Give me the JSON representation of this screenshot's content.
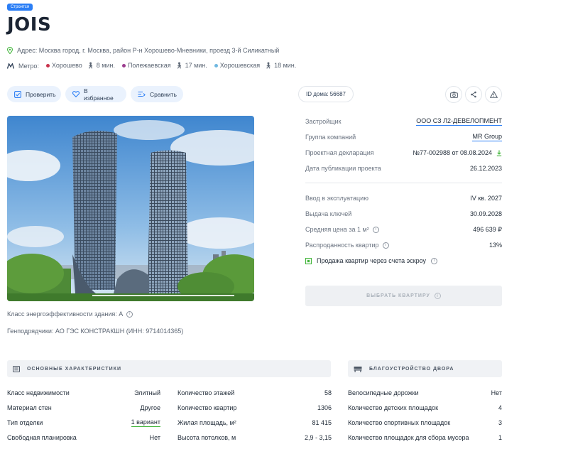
{
  "header": {
    "status_badge": "Строится",
    "title": "JOIS",
    "address": "Адрес: Москва город, г. Москва, район Р-н Хорошево-Мневники, проезд 3-й Силикатный",
    "metro_label": "Метро:",
    "metro": [
      {
        "name": "Хорошево",
        "time": "8 мин.",
        "color": "#c8324b"
      },
      {
        "name": "Полежаевская",
        "time": "17 мин.",
        "color": "#9b3c8e"
      },
      {
        "name": "Хорошевская",
        "time": "18 мин.",
        "color": "#6fb8e0"
      }
    ]
  },
  "actions": {
    "check_label": "Проверить",
    "favorite_label": "В избранное",
    "compare_label": "Сравнить",
    "id_label": "ID дома: 56687"
  },
  "notes": {
    "energy_class": "Класс энергоэффективности здания: А",
    "contractors": "Генподрядчики: АО ГЭС КОНСТРАКШН (ИНН: 9714014365)"
  },
  "info_top": [
    {
      "key": "Застройщик",
      "value": "ООО СЗ Л2-ДЕВЕЛОПМЕНТ",
      "link": true
    },
    {
      "key": "Группа компаний",
      "value": "MR Group",
      "link": true
    },
    {
      "key": "Проектная декларация",
      "value": "№77-002988 от 08.08.2024",
      "link": false
    },
    {
      "key": "Дата публикации проекта",
      "value": "26.12.2023",
      "link": false
    }
  ],
  "info_bottom": [
    {
      "key": "Ввод в эксплуатацию",
      "value": "IV кв. 2027"
    },
    {
      "key": "Выдача ключей",
      "value": "30.09.2028"
    },
    {
      "key": "Средняя цена за 1 м²",
      "value": "496 639 ₽"
    },
    {
      "key": "Распроданность квартир",
      "value": "13%"
    }
  ],
  "escrow_label": "Продажа квартир через счета эскроу",
  "cta_label": "ВЫБРАТЬ КВАРТИРУ",
  "sections": {
    "main_title": "ОСНОВНЫЕ ХАРАКТЕРИСТИКИ",
    "yard_title": "БЛАГОУСТРОЙСТВО ДВОРА"
  },
  "main_col1": [
    {
      "key": "Класс недвижимости",
      "value": "Элитный"
    },
    {
      "key": "Материал стен",
      "value": "Другое"
    },
    {
      "key": "Тип отделки",
      "value": "1 вариант"
    },
    {
      "key": "Свободная планировка",
      "value": "Нет"
    }
  ],
  "main_col2": [
    {
      "key": "Количество этажей",
      "value": "58"
    },
    {
      "key": "Количество квартир",
      "value": "1306"
    },
    {
      "key": "Жилая площадь, м²",
      "value": "81 415"
    },
    {
      "key": "Высота потолков, м",
      "value": "2,9 - 3,15"
    }
  ],
  "yard": [
    {
      "key": "Велосипедные дорожки",
      "value": "Нет"
    },
    {
      "key": "Количество детских площадок",
      "value": "4"
    },
    {
      "key": "Количество спортивных площадок",
      "value": "3"
    },
    {
      "key": "Количество площадок для сбора мусора",
      "value": "1"
    }
  ],
  "colors": {
    "accent": "#2b7ef5",
    "pill_bg": "#eaf2fd",
    "download": "#41b53a"
  }
}
